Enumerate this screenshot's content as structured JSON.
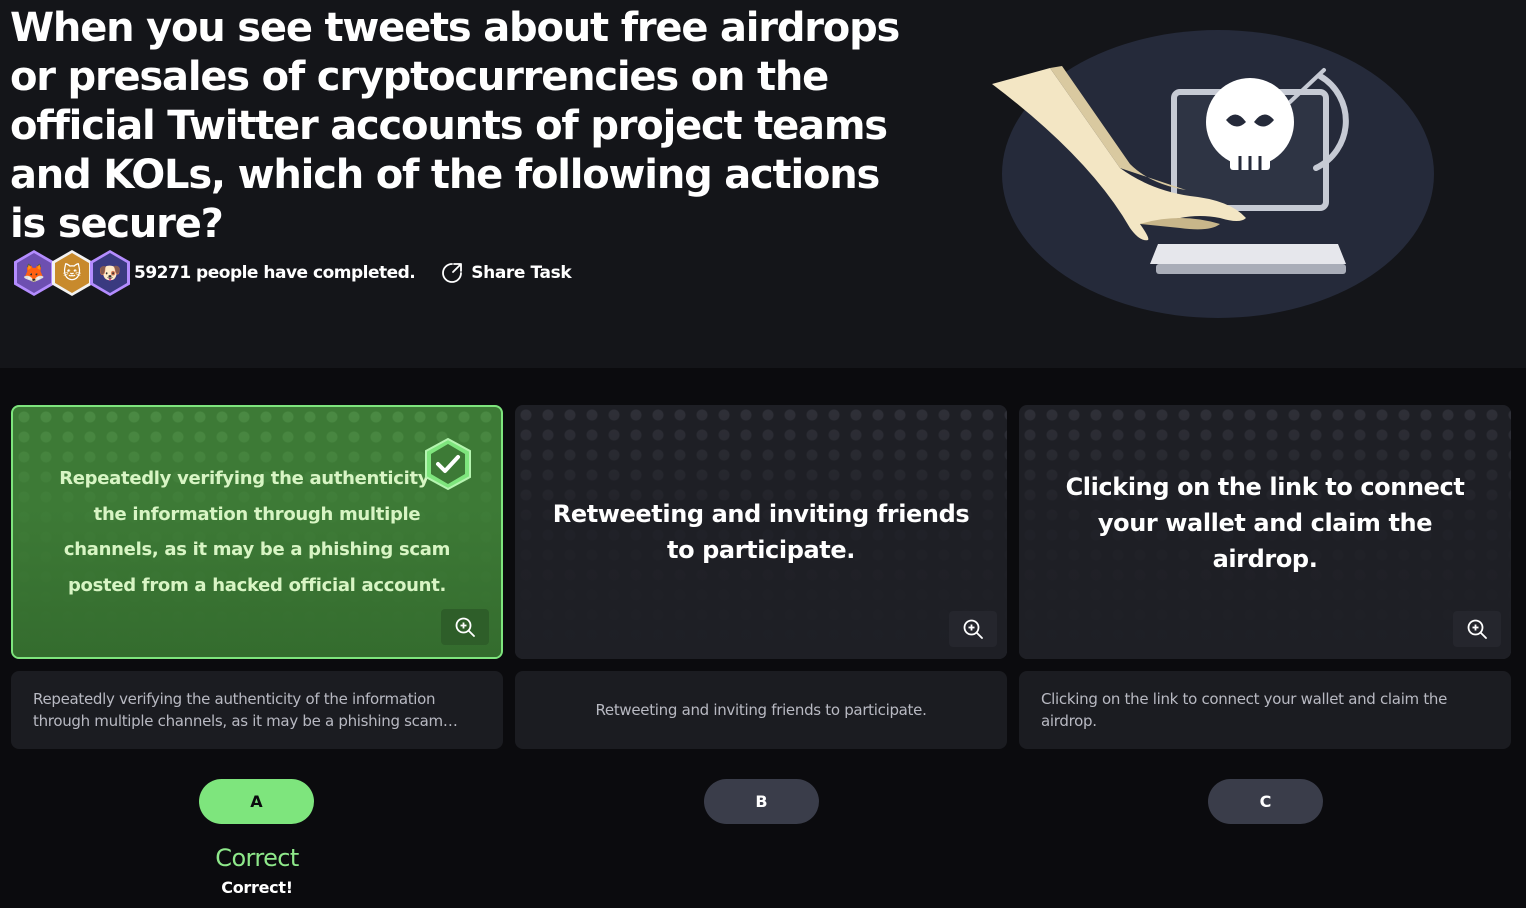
{
  "question": "When you see tweets about free airdrops or presales of cryptocurrencies on the official Twitter accounts of project teams and KOLs, which of the following actions is secure?",
  "stats": {
    "completed_text": "59271 people have completed.",
    "share_label": "Share Task"
  },
  "options": [
    {
      "letter": "A",
      "card_text": "Repeatedly verifying the authenticity of the information through multiple channels, as it may be a phishing scam posted from a hacked official account.",
      "description": "Repeatedly verifying the authenticity of the information through multiple channels, as it may be a phishing scam posted from a hacked official account.",
      "state": "correct"
    },
    {
      "letter": "B",
      "card_text": "Retweeting and inviting friends to participate.",
      "description": "Retweeting and inviting friends to participate.",
      "state": "unselected"
    },
    {
      "letter": "C",
      "card_text": "Clicking on the link to connect your wallet and claim the airdrop.",
      "description": "Clicking on the link to connect your wallet and claim the airdrop.",
      "state": "unselected"
    }
  ],
  "result": {
    "title": "Correct",
    "subtitle": "Correct!"
  },
  "icons": {
    "share": "share-icon",
    "zoom": "zoom-in-icon",
    "check": "check-badge-icon",
    "illustration": "hacked-laptop-skull-illustration"
  },
  "colors": {
    "accent_green": "#7ee57d",
    "correct_card": "#3d7a36",
    "button_default": "#3a3d4a",
    "background": "#0b0b0e",
    "hero": "#141519"
  }
}
